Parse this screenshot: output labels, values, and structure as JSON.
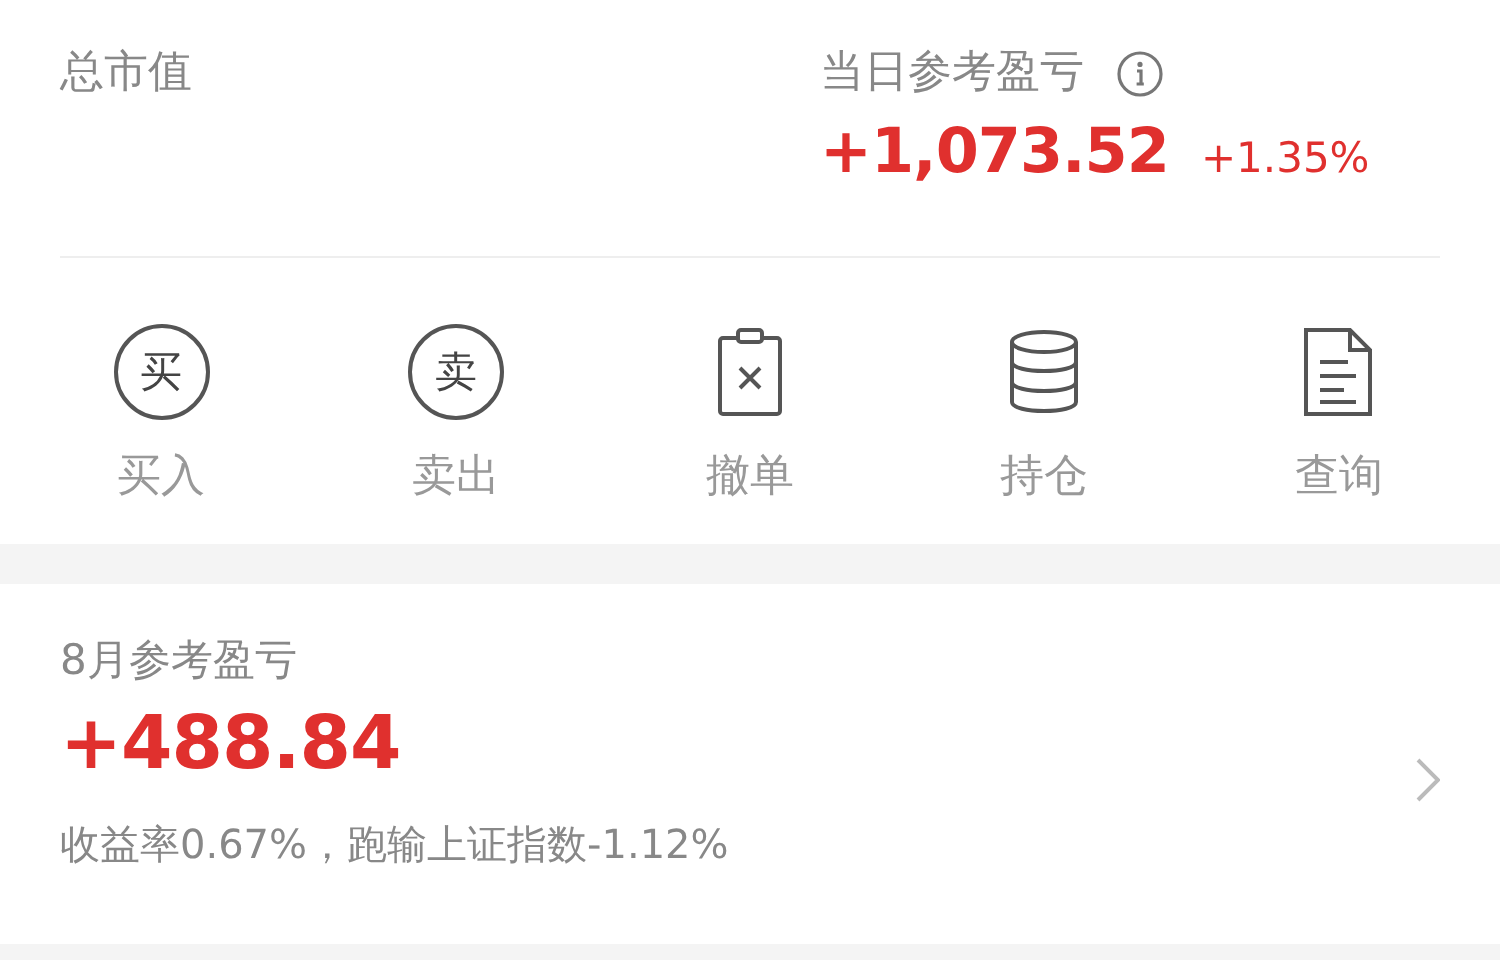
{
  "summary": {
    "market_value_label": "总市值",
    "daily_pl_label": "当日参考盈亏",
    "daily_pl": "+1,073.52",
    "daily_pl_pct": "+1.35%"
  },
  "actions": [
    {
      "kind": "circle-char",
      "glyph": "买",
      "label": "买入"
    },
    {
      "kind": "circle-char",
      "glyph": "卖",
      "label": "卖出"
    },
    {
      "kind": "cancel-order",
      "label": "撤单"
    },
    {
      "kind": "holdings",
      "label": "持仓"
    },
    {
      "kind": "query",
      "label": "查询"
    }
  ],
  "monthly": {
    "title": "8月参考盈亏",
    "value": "+488.84",
    "detail": "收益率0.67%，跑输上证指数-1.12%"
  }
}
